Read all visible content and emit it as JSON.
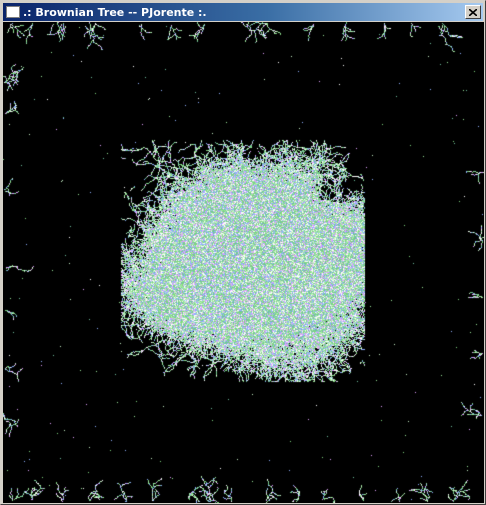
{
  "window": {
    "title": ".: Brownian Tree -- PJorente :.",
    "close_icon": "close-icon",
    "app_icon": "window-app-icon"
  },
  "canvas": {
    "background_color": "#000000",
    "particle_colors": [
      "#7fd67f",
      "#9ee89e",
      "#c8f0c8",
      "#8fb0ff",
      "#e0a0ff",
      "#ffffff",
      "#70c0a0"
    ]
  }
}
